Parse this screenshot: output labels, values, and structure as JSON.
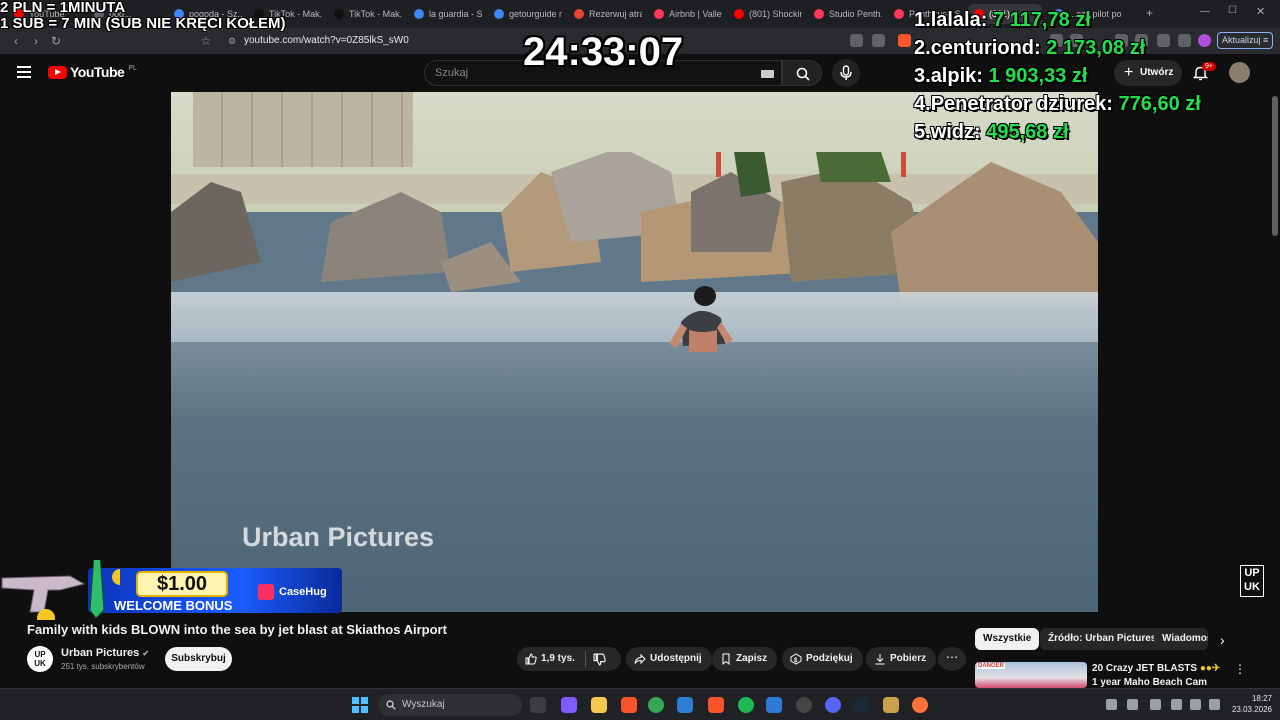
{
  "browser": {
    "tabs": [
      {
        "label": "YouTube",
        "color": "#ff0000"
      },
      {
        "label": "pod...",
        "color": "#5f6368"
      },
      {
        "label": "pogoda - Sz...",
        "color": "#4285f4"
      },
      {
        "label": "TikTok - Mak...",
        "color": "#111111"
      },
      {
        "label": "TikTok - Mak...",
        "color": "#111111"
      },
      {
        "label": "la guardia - S...",
        "color": "#4285f4"
      },
      {
        "label": "getourguide m...",
        "color": "#4285f4"
      },
      {
        "label": "Rezerwuj atra...",
        "color": "#e94335"
      },
      {
        "label": "Airbnb | Valle...",
        "color": "#ff385c"
      },
      {
        "label": "(801) Shockin...",
        "color": "#ff0000"
      },
      {
        "label": "Studio Penth...",
        "color": "#ff385c"
      },
      {
        "label": "Penthouse S...",
        "color": "#ff385c"
      },
      {
        "label": "(801)...",
        "color": "#ff0000"
      },
      {
        "label": "...czy pilot po k...",
        "color": "#4285f4"
      }
    ],
    "new_tab": "+",
    "url": "youtube.com/watch?v=0Z85lkS_sW0",
    "update_label": "Aktualizuj"
  },
  "youtube": {
    "logo_text": "YouTube",
    "region": "PL",
    "search_placeholder": "Szukaj",
    "create_label": "Utwórz",
    "notif_count": "9+"
  },
  "overlay": {
    "promo_line1": "2 PLN =  1MINUTA",
    "promo_line2": "1 SUB = 7 MIN (SUB NIE KRĘCI KOŁEM)",
    "timer": "24:33:07",
    "leaderboard": [
      {
        "rank": "1.",
        "name": "lalala:",
        "amount": "7 117,78 zł"
      },
      {
        "rank": "2.",
        "name": "centuriond:",
        "amount": "2 173,08 zł"
      },
      {
        "rank": "3.",
        "name": "alpik:",
        "amount": "1 903,33 zł"
      },
      {
        "rank": "4.",
        "name": "Penetrator dziurek:",
        "amount": "776,60 zł"
      },
      {
        "rank": "5.",
        "name": "widz:",
        "amount": "495,68 zł"
      }
    ]
  },
  "ad": {
    "price": "$1.00",
    "bonus": "WELCOME BONUS",
    "brand": "CaseHug"
  },
  "video": {
    "watermark": "Urban Pictures",
    "corner_logo_top": "UP",
    "corner_logo_bottom": "UK",
    "title": "Family with kids BLOWN into the sea by jet blast at Skiathos Airport",
    "channel_avatar_top": "UP",
    "channel_avatar_bottom": "UK",
    "channel_name": "Urban Pictures",
    "verified": "✔",
    "subscribers": "251 tys. subskrybentów",
    "subscribe_label": "Subskrybuj",
    "likes": "1,9 tys.",
    "share_label": "Udostępnij",
    "save_label": "Zapisz",
    "thanks_label": "Podziękuj",
    "download_label": "Pobierz",
    "more_label": "⋯"
  },
  "chips": {
    "all": "Wszystkie",
    "source": "Źródło: Urban Pictures",
    "more": "Wiadomości",
    "next": "›"
  },
  "related": {
    "title": "20 Crazy JET BLASTS",
    "subtitle": "1 year Maho Beach Cam",
    "thumb_label": "DANGER",
    "menu": "⋮"
  },
  "taskbar": {
    "search_placeholder": "Wyszukaj",
    "time": "18:27",
    "date": "23.03.2026"
  }
}
